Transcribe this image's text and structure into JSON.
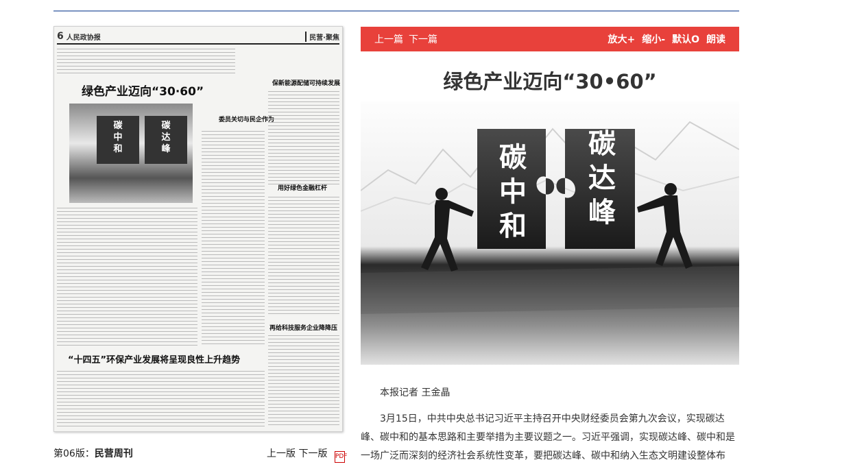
{
  "page": {
    "volume_label": "第06版：",
    "volume_name": "民营周刊",
    "prev_page": "上一版",
    "next_page": "下一版",
    "pdf_icon": "pdf-icon"
  },
  "newspaper": {
    "page_number": "6",
    "masthead": "人民政协报",
    "section": "民营·聚焦",
    "headline": "绿色产业迈向“30·60”",
    "image_left_text": "碳中和",
    "image_right_text": "碳达峰",
    "sub1": "委员关切与民企作为",
    "sub2": "保新能源配储可持续发展",
    "sub3": "用好绿色金融杠杆",
    "sub4": "再给科技服务企业降降压",
    "bottom_headline": "“十四五”环保产业发展将呈现良性上升趋势"
  },
  "article": {
    "nav_prev": "上一篇",
    "nav_next": "下一篇",
    "zoom_in": "放大+",
    "zoom_out": "缩小-",
    "default": "默认O",
    "read_aloud": "朗读",
    "title": "绿色产业迈向“30•60”",
    "image_left_text": "碳中和",
    "image_right_text": "碳达峰",
    "author": "本报记者 王金晶",
    "body": "3月15日，中共中央总书记习近平主持召开中央财经委员会第九次会议，实现碳达峰、碳中和的基本思路和主要举措为主要议题之一。习近平强调，实现碳达峰、碳中和是一场广泛而深刻的经济社会系统性变革，要把碳达峰、碳中和纳入生态文明建设整体布"
  }
}
